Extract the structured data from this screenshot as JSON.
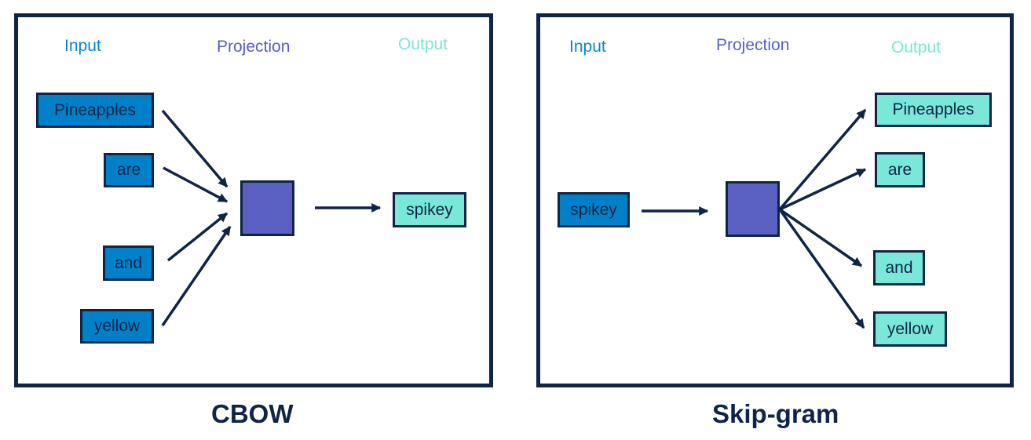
{
  "cbow": {
    "caption": "CBOW",
    "headers": {
      "input": "Input",
      "projection": "Projection",
      "output": "Output"
    },
    "inputs": [
      "Pineapples",
      "are",
      "and",
      "yellow"
    ],
    "output": "spikey"
  },
  "skipgram": {
    "caption": "Skip-gram",
    "headers": {
      "input": "Input",
      "projection": "Projection",
      "output": "Output"
    },
    "input": "spikey",
    "outputs": [
      "Pineapples",
      "are",
      "and",
      "yellow"
    ]
  },
  "colors": {
    "frame": "#0f2447",
    "input": "#0080c8",
    "projection": "#5a60c0",
    "output": "#7ae8d8"
  }
}
